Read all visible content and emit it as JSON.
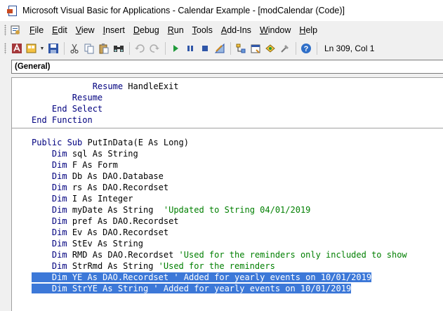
{
  "window": {
    "title": "Microsoft Visual Basic for Applications - Calendar Example - [modCalendar (Code)]"
  },
  "menu": {
    "items": [
      {
        "accel": "F",
        "rest": "ile"
      },
      {
        "accel": "E",
        "rest": "dit"
      },
      {
        "accel": "V",
        "rest": "iew"
      },
      {
        "accel": "I",
        "rest": "nsert"
      },
      {
        "accel": "D",
        "rest": "ebug"
      },
      {
        "accel": "R",
        "rest": "un"
      },
      {
        "accel": "T",
        "rest": "ools"
      },
      {
        "accel": "A",
        "rest": "dd-Ins"
      },
      {
        "accel": "W",
        "rest": "indow"
      },
      {
        "accel": "H",
        "rest": "elp"
      }
    ]
  },
  "toolbar": {
    "position": "Ln 309, Col 1",
    "buttons": [
      "view-access-icon",
      "insert-module-icon",
      "save-icon",
      "cut-icon",
      "copy-icon",
      "paste-icon",
      "find-icon",
      "undo-icon",
      "redo-icon",
      "run-icon",
      "break-icon",
      "reset-icon",
      "design-mode-icon",
      "project-explorer-icon",
      "properties-icon",
      "object-browser-icon",
      "toolbox-icon",
      "help-icon"
    ]
  },
  "object_combo": {
    "value": "(General)"
  },
  "code": {
    "lines": [
      {
        "indent": "            ",
        "kw": "Resume",
        "text": " HandleExit",
        "comment": "",
        "sel": false
      },
      {
        "indent": "        ",
        "kw": "Resume",
        "text": "",
        "comment": "",
        "sel": false
      },
      {
        "indent": "    ",
        "kw": "End Select",
        "text": "",
        "comment": "",
        "sel": false
      },
      {
        "indent": "",
        "kw": "End Function",
        "text": "",
        "comment": "",
        "sel": false
      },
      {
        "indent": "",
        "kw": "Public Sub",
        "text": " PutInData(E As Long)",
        "comment": "",
        "sel": false
      },
      {
        "indent": "    ",
        "kw": "Dim",
        "text": " sql As String",
        "comment": "",
        "sel": false
      },
      {
        "indent": "    ",
        "kw": "Dim",
        "text": " F As Form",
        "comment": "",
        "sel": false
      },
      {
        "indent": "    ",
        "kw": "Dim",
        "text": " Db As DAO.Database",
        "comment": "",
        "sel": false
      },
      {
        "indent": "    ",
        "kw": "Dim",
        "text": " rs As DAO.Recordset",
        "comment": "",
        "sel": false
      },
      {
        "indent": "    ",
        "kw": "Dim",
        "text": " I As Integer",
        "comment": "",
        "sel": false
      },
      {
        "indent": "    ",
        "kw": "Dim",
        "text": " myDate As String  ",
        "comment": "'Updated to String 04/01/2019",
        "sel": false
      },
      {
        "indent": "    ",
        "kw": "Dim",
        "text": " pref As DAO.Recordset",
        "comment": "",
        "sel": false
      },
      {
        "indent": "    ",
        "kw": "Dim",
        "text": " Ev As DAO.Recordset",
        "comment": "",
        "sel": false
      },
      {
        "indent": "    ",
        "kw": "Dim",
        "text": " StEv As String",
        "comment": "",
        "sel": false
      },
      {
        "indent": "    ",
        "kw": "Dim",
        "text": " RMD As DAO.Recordset ",
        "comment": "'Used for the reminders only included to show",
        "sel": false
      },
      {
        "indent": "    ",
        "kw": "Dim",
        "text": " StrRmd As String ",
        "comment": "'Used for the reminders",
        "sel": false
      },
      {
        "indent": "    ",
        "kw": "Dim",
        "text": " YE As DAO.Recordset ",
        "comment": "' Added for yearly events on 10/01/2019",
        "sel": true
      },
      {
        "indent": "    ",
        "kw": "Dim",
        "text": " StrYE As String ",
        "comment": "' Added for yearly events on 10/01/2019",
        "sel": true
      }
    ]
  }
}
